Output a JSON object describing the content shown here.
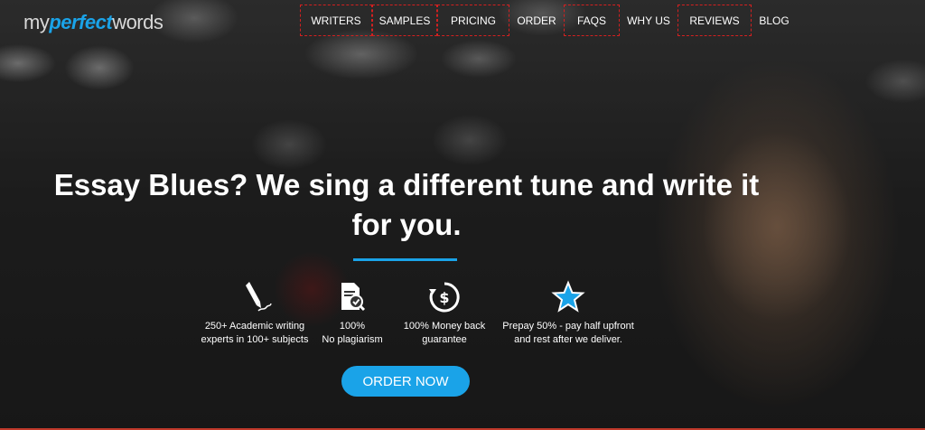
{
  "brand": {
    "logo_prefix": "my",
    "logo_accent": "perfect",
    "logo_suffix": "words",
    "accent_color": "#1aa3e8"
  },
  "nav": {
    "items": [
      {
        "label": "WRITERS",
        "boxed": true
      },
      {
        "label": "SAMPLES",
        "boxed": true
      },
      {
        "label": "PRICING",
        "boxed": true
      },
      {
        "label": "ORDER",
        "boxed": false
      },
      {
        "label": "FAQS",
        "boxed": true
      },
      {
        "label": "WHY US",
        "boxed": false
      },
      {
        "label": "REVIEWS",
        "boxed": true
      },
      {
        "label": "BLOG",
        "boxed": false
      }
    ],
    "highlight_color": "#d42020"
  },
  "hero": {
    "headline_line1": "Essay Blues? We sing a different tune and write it",
    "headline_line2": "for you.",
    "features": [
      {
        "icon": "pen-icon",
        "text": "250+ Academic writing\nexperts in 100+ subjects"
      },
      {
        "icon": "document-check-icon",
        "text": "100%\nNo plagiarism"
      },
      {
        "icon": "money-back-icon",
        "text": "100% Money back\nguarantee"
      },
      {
        "icon": "star-icon",
        "text": "Prepay 50% - pay half upfront\nand rest after we deliver."
      }
    ],
    "cta_label": "ORDER NOW"
  }
}
